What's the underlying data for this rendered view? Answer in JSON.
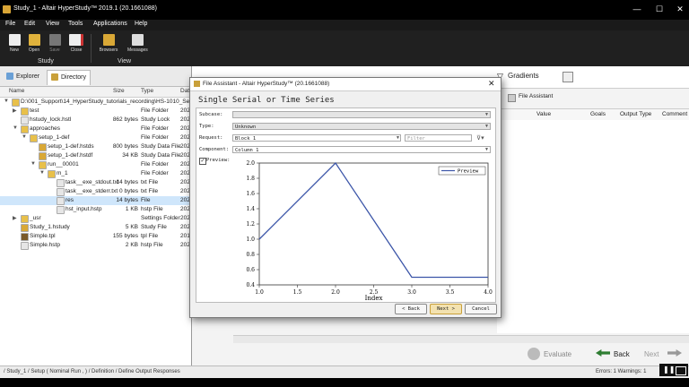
{
  "window": {
    "title": "Study_1 - Altair HyperStudy™ 2019.1 (20.1661088)",
    "min": "—",
    "max": "☐",
    "close": "✕"
  },
  "menu": [
    "File",
    "Edit",
    "View",
    "Tools",
    "Applications",
    "Help"
  ],
  "ribbon": {
    "study_buttons": [
      "New",
      "Open",
      "Save",
      "Close"
    ],
    "study_group": "Study",
    "view_buttons": [
      "Browsers",
      "Messages"
    ],
    "view_group": "View"
  },
  "left_panel": {
    "tabs": [
      "Explorer",
      "Directory"
    ],
    "columns": [
      "Name",
      "Size",
      "Type",
      "Dat"
    ],
    "rows": [
      {
        "name": "D:\\001_Support\\14_HyperStudy_tutorials_recording\\HS-1010_Set Up",
        "size": "",
        "type": "",
        "date": "",
        "level": 0,
        "expander": "▼",
        "kind": "folder",
        "selected": false
      },
      {
        "name": "test",
        "size": "",
        "type": "File Folder",
        "date": "202",
        "level": 1,
        "expander": "▶",
        "kind": "folder",
        "selected": false
      },
      {
        "name": "hstudy_lock.hstl",
        "size": "862 bytes",
        "type": "Study Lock",
        "date": "202",
        "level": 1,
        "expander": "",
        "kind": "file",
        "selected": false
      },
      {
        "name": "approaches",
        "size": "",
        "type": "File Folder",
        "date": "202",
        "level": 1,
        "expander": "▼",
        "kind": "folder",
        "selected": false
      },
      {
        "name": "setup_1-def",
        "size": "",
        "type": "File Folder",
        "date": "202",
        "level": 2,
        "expander": "▼",
        "kind": "folder",
        "selected": false
      },
      {
        "name": "setup_1-def.hstds",
        "size": "800 bytes",
        "type": "Study Data File",
        "date": "202",
        "level": 3,
        "expander": "",
        "kind": "study",
        "selected": false
      },
      {
        "name": "setup_1-def.hstdf",
        "size": "34 KB",
        "type": "Study Data File",
        "date": "202",
        "level": 3,
        "expander": "",
        "kind": "study",
        "selected": false
      },
      {
        "name": "run__00001",
        "size": "",
        "type": "File Folder",
        "date": "202",
        "level": 3,
        "expander": "▼",
        "kind": "folder",
        "selected": false
      },
      {
        "name": "m_1",
        "size": "",
        "type": "File Folder",
        "date": "202",
        "level": 4,
        "expander": "▼",
        "kind": "folder",
        "selected": false
      },
      {
        "name": "task__exe_stdout.txt",
        "size": "14 bytes",
        "type": "txt File",
        "date": "202",
        "level": 5,
        "expander": "",
        "kind": "file",
        "selected": false
      },
      {
        "name": "task__exe_stderr.txt",
        "size": "0 bytes",
        "type": "txt File",
        "date": "202",
        "level": 5,
        "expander": "",
        "kind": "file",
        "selected": false
      },
      {
        "name": "res",
        "size": "14 bytes",
        "type": "File",
        "date": "202",
        "level": 5,
        "expander": "",
        "kind": "file",
        "selected": true
      },
      {
        "name": "hst_input.hstp",
        "size": "1 KB",
        "type": "hstp File",
        "date": "202",
        "level": 5,
        "expander": "",
        "kind": "file",
        "selected": false
      },
      {
        "name": "_usr",
        "size": "",
        "type": "Settings Folder",
        "date": "202",
        "level": 1,
        "expander": "▶",
        "kind": "folder",
        "selected": false
      },
      {
        "name": "Study_1.hstudy",
        "size": "5 KB",
        "type": "Study File",
        "date": "202",
        "level": 1,
        "expander": "",
        "kind": "study",
        "selected": false
      },
      {
        "name": "Simple.tpl",
        "size": "155 bytes",
        "type": "tpl File",
        "date": "201",
        "level": 1,
        "expander": "",
        "kind": "tpl",
        "selected": false
      },
      {
        "name": "Simple.hstp",
        "size": "2 KB",
        "type": "hstp File",
        "date": "202",
        "level": 1,
        "expander": "",
        "kind": "file",
        "selected": false
      }
    ]
  },
  "main": {
    "gradients_label": "Gradients",
    "file_assistant_link": "File Assistant",
    "columns": [
      "Value",
      "Goals",
      "Output Type",
      "Comment"
    ],
    "evaluate_label": "Evaluate",
    "back_label": "Back",
    "next_label": "Next"
  },
  "dialog": {
    "title": "File Assistant - Altair HyperStudy™ (20.1661088)",
    "heading": "Single Serial or Time Series",
    "fields": {
      "subcase_label": "Subcase:",
      "subcase_value": "",
      "type_label": "Type:",
      "type_value": "Unknown",
      "request_label": "Request:",
      "request_value": "Block 1",
      "filter_placeholder": "Filter",
      "component_label": "Component:",
      "component_value": "Column 1",
      "preview_label": "Preview:"
    },
    "buttons": {
      "back": "< Back",
      "next": "Next >",
      "cancel": "Cancel"
    }
  },
  "chart_data": {
    "type": "line",
    "xlabel": "Index",
    "ylabel": "",
    "xlim": [
      1.0,
      4.0
    ],
    "ylim": [
      0.4,
      2.0
    ],
    "xticks": [
      "1.0",
      "1.5",
      "2.0",
      "2.5",
      "3.0",
      "3.5",
      "4.0"
    ],
    "yticks": [
      "0.4",
      "0.6",
      "0.8",
      "1.0",
      "1.2",
      "1.4",
      "1.6",
      "1.8",
      "2.0"
    ],
    "series": [
      {
        "name": "Preview",
        "x": [
          1.0,
          2.0,
          3.0,
          4.0
        ],
        "y": [
          1.0,
          2.0,
          0.5,
          0.5
        ],
        "color": "#3b55a8"
      }
    ],
    "legend": "top-right",
    "grid": false
  },
  "status": {
    "breadcrumb": "/ Study_1 / Setup ( Nominal Run , ) / Definition / Define Output Responses",
    "counts": "Errors: 1  Warnings: 1",
    "pause_icon": "pause-icon"
  },
  "colors": {
    "accent": "#c9a03a",
    "selection": "#cfe6fb",
    "line": "#3b55a8"
  }
}
